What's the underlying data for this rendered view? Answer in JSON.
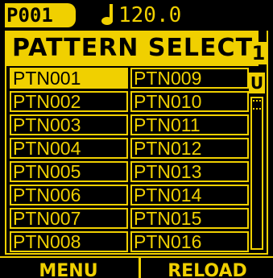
{
  "status": {
    "pattern_id": "P001",
    "tempo": "120.0",
    "note_icon": "quarter-note-icon"
  },
  "panel": {
    "title": "PATTERN SELECT",
    "bank": "1",
    "scroll_up_label": "U"
  },
  "patterns": {
    "left": [
      "PTN001",
      "PTN002",
      "PTN003",
      "PTN004",
      "PTN005",
      "PTN006",
      "PTN007",
      "PTN008"
    ],
    "right": [
      "PTN009",
      "PTN010",
      "PTN011",
      "PTN012",
      "PTN013",
      "PTN014",
      "PTN015",
      "PTN016"
    ],
    "selected": "PTN001"
  },
  "softkeys": {
    "menu": "MENU",
    "reload": "RELOAD"
  },
  "colors": {
    "accent": "#f0d000",
    "background": "#000000"
  }
}
